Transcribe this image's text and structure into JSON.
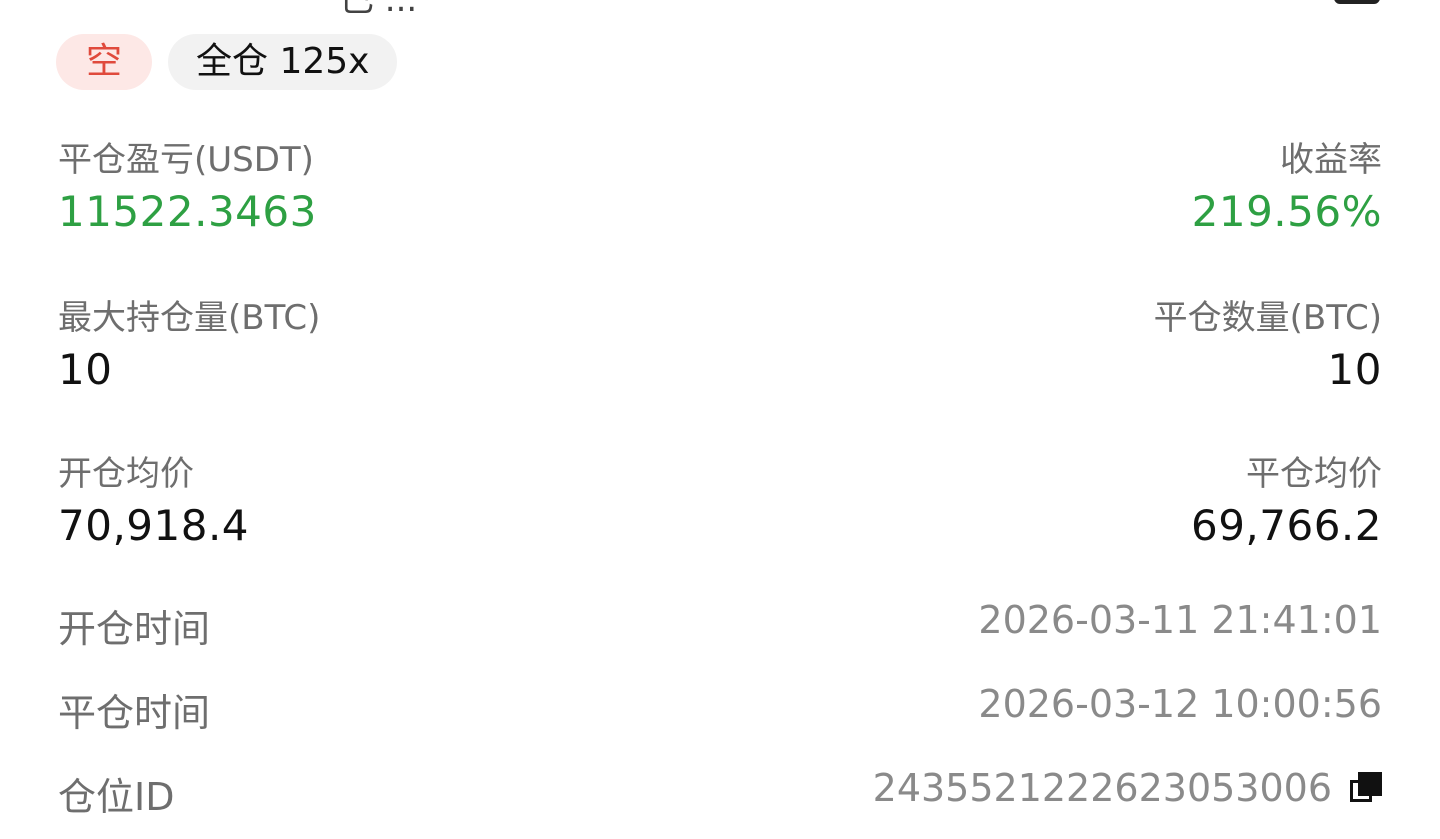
{
  "header": {
    "cut_text": "已 ...",
    "tags": {
      "side": "空",
      "margin": "全仓 125x"
    }
  },
  "colors": {
    "profit_green": "#2ea043",
    "short_red": "#e04a3c",
    "short_bg": "#fde8e6",
    "tag_bg": "#f2f2f2"
  },
  "pnl": {
    "label": "平仓盈亏(USDT)",
    "value": "11522.3463"
  },
  "roi": {
    "label": "收益率",
    "value": "219.56%"
  },
  "max_position": {
    "label": "最大持仓量(BTC)",
    "value": "10"
  },
  "close_qty": {
    "label": "平仓数量(BTC)",
    "value": "10"
  },
  "open_avg": {
    "label": "开仓均价",
    "value": "70,918.4"
  },
  "close_avg": {
    "label": "平仓均价",
    "value": "69,766.2"
  },
  "open_time": {
    "label": "开仓时间",
    "value": "2026-03-11 21:41:01"
  },
  "close_time": {
    "label": "平仓时间",
    "value": "2026-03-12 10:00:56"
  },
  "position_id": {
    "label": "仓位ID",
    "value": "243552122262305 3006",
    "icon": "copy-icon"
  }
}
